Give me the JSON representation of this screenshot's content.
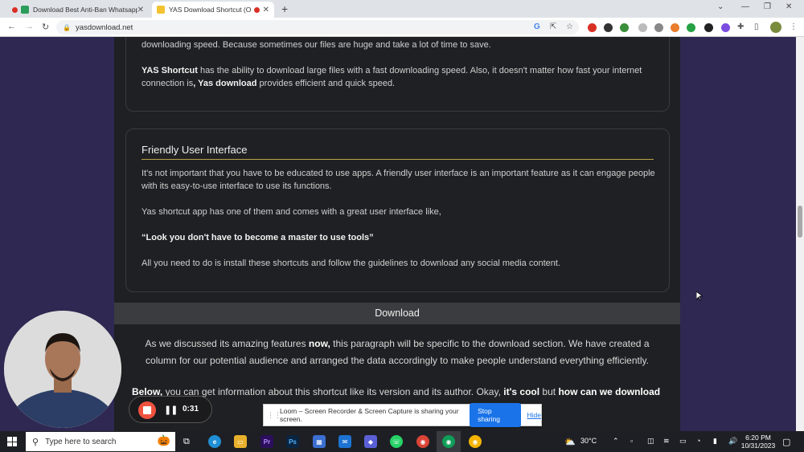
{
  "browser": {
    "tabs": [
      {
        "title": "Download Best Anti-Ban Whatsapp",
        "active": false
      },
      {
        "title": "YAS Download Shortcut (Of",
        "active": true
      }
    ],
    "new_tab": "+",
    "url": "yasdownload.net"
  },
  "article": {
    "intro_tail": "downloading speed. Because sometimes our files are huge and take a lot of time to save.",
    "speed": {
      "bold1": "YAS Shortcut",
      "text1": " has the ability to download large files with a fast downloading speed. Also, it doesn't matter how fast your internet connection is",
      "bold2": ", Yas download",
      "text2": " provides efficient and quick speed."
    },
    "ui_section": {
      "heading": "Friendly User Interface",
      "p1": "It's not important that you have to be educated to use apps. A friendly user interface is an important feature as it can engage people with its easy-to-use interface to use its functions.",
      "p2": "Yas shortcut app has one of them and comes with a great user interface like,",
      "quote": "“Look you don't have to become a master to use tools”",
      "p3": "All you need to do is install these shortcuts and follow the guidelines to download any social media content."
    },
    "download": {
      "title": "Download",
      "p1_a": "As we discussed its amazing features ",
      "p1_b": "now,",
      "p1_c": " this paragraph will be specific to the download section. We have created a column for our potential audience and arranged the data accordingly to make people understand everything efficiently.",
      "p2_a": "Below,",
      "p2_b": " you can get information about this shortcut like its version and its author. Okay, ",
      "p2_c": "it's cool",
      "p2_d": " but ",
      "p2_e": "how can we download"
    }
  },
  "loom": {
    "timer": "0:31",
    "share_message": "Loom – Screen Recorder & Screen Capture is sharing your screen.",
    "stop_label": "Stop sharing",
    "hide_label": "Hide"
  },
  "taskbar": {
    "search_placeholder": "Type here to search",
    "weather": "30°C",
    "time": "6:20 PM",
    "date": "10/31/2023"
  },
  "colors": {
    "page_bg": "#2e2852",
    "content_bg": "#1f2023",
    "accent_rule": "#b9a24a",
    "loom_stop": "#f0523e",
    "link_blue": "#1a73e8"
  }
}
